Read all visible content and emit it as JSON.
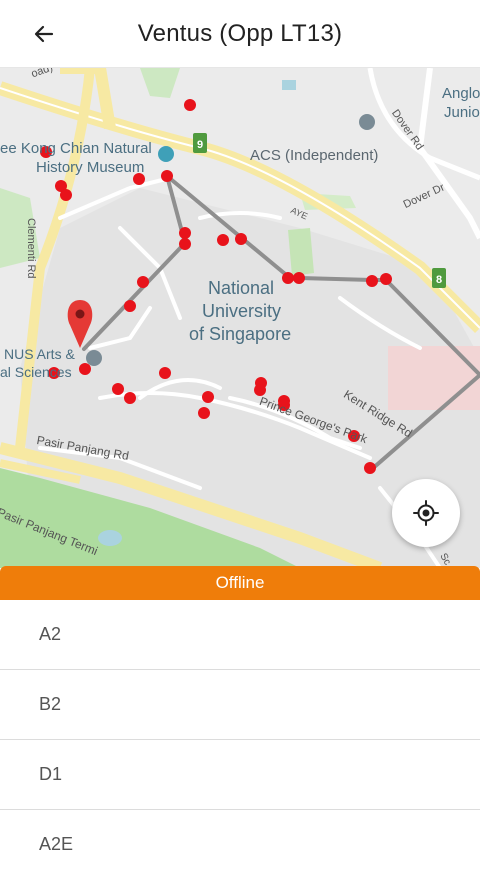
{
  "header": {
    "title": "Ventus (Opp LT13)",
    "back_icon": "arrow-left-icon"
  },
  "map": {
    "labels": {
      "museum": "Lee Kong Chian Natural History Museum",
      "museum_line1": "ee Kong Chian Natural",
      "museum_line2": "History Museum",
      "acs": "ACS (Independent)",
      "nus_line1": "National",
      "nus_line2": "University",
      "nus_line3": "of Singapore",
      "arts_line1": "NUS Arts &",
      "arts_line2": "al Sciences",
      "clementi": "Clementi Rd",
      "pasir": "Pasir Panjang Rd",
      "pasir_term": "Pasir Panjang Termi",
      "kent_ridge": "Kent Ridge Rd",
      "prince_george": "Prince George's Park",
      "dover_rd": "Dover Rd",
      "dover_dr": "Dover Dr",
      "aye": "AYE",
      "anglo_line1": "Anglo",
      "anglo_line2": "Junio",
      "road_top": "oad)",
      "shield_9": "9",
      "shield_8": "8",
      "sc": "Sc"
    },
    "colors": {
      "stop": "#e8131b",
      "route": "#8f8f8f",
      "accent": "#ef7d0a",
      "road_major": "#f7e9a3",
      "park": "#aedc9f"
    }
  },
  "locate_button": {
    "icon": "crosshair-icon"
  },
  "status": {
    "label": "Offline"
  },
  "services": [
    {
      "name": "A2"
    },
    {
      "name": "B2"
    },
    {
      "name": "D1"
    },
    {
      "name": "A2E"
    }
  ]
}
